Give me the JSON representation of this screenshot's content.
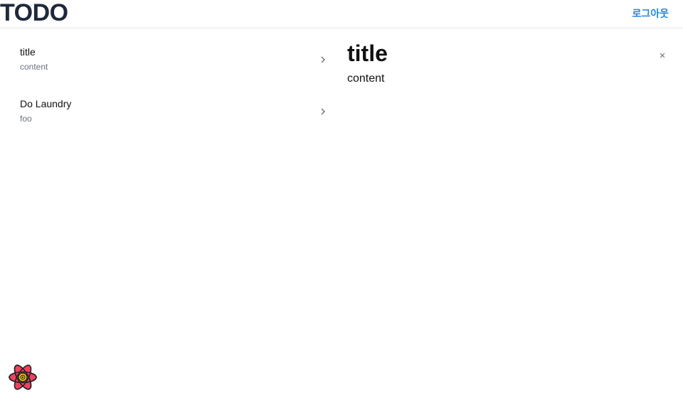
{
  "header": {
    "title": "TODO",
    "logout_label": "로그아웃"
  },
  "todos": [
    {
      "title": "title",
      "content": "content"
    },
    {
      "title": "Do Laundry",
      "content": "foo"
    }
  ],
  "detail": {
    "title": "title",
    "content": "content"
  },
  "colors": {
    "title": "#1e293b",
    "link": "#1e88e5",
    "subtext": "#6b7280",
    "logo_fill": "#f2415f",
    "logo_core": "#f5d20b"
  },
  "icons": [
    "chevron-right-icon",
    "close-icon",
    "react-devtools-icon"
  ]
}
